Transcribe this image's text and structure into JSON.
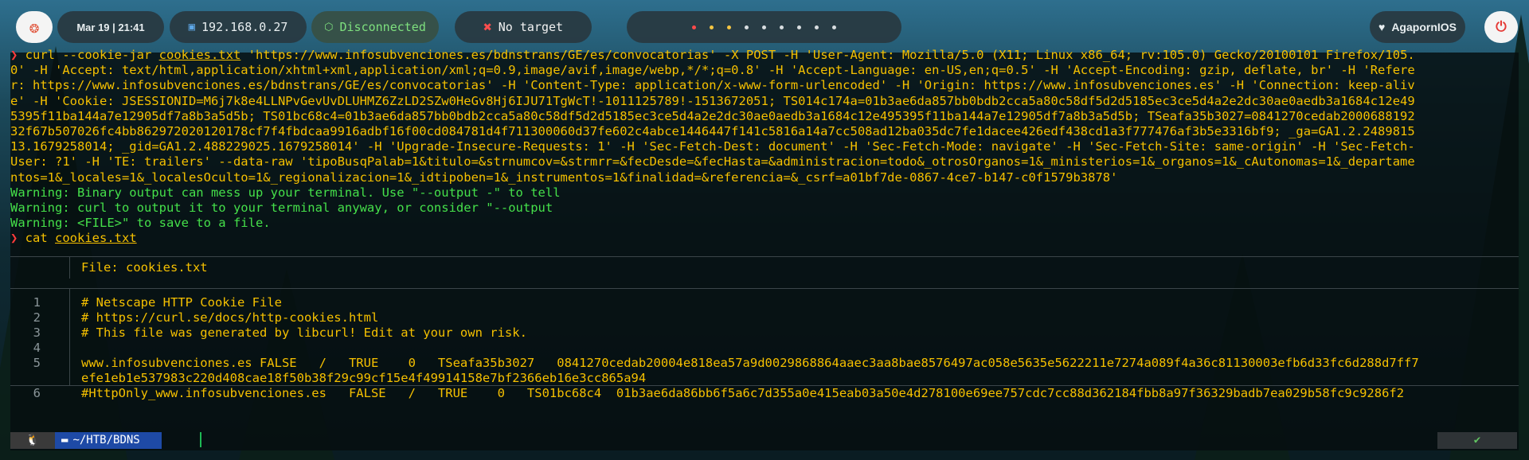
{
  "topbar": {
    "logo_icon": "parrot-logo-icon",
    "date_time": "Mar 19  |  21:41",
    "ip_address": "192.168.0.27",
    "vpn_status": "Disconnected",
    "target": "No target",
    "user": "AgapornIOS",
    "workspaces_count": 9,
    "active_workspace": 1
  },
  "terminal": {
    "lines": [
      {
        "kind": "cmd",
        "prompt": "❯ ",
        "pre": "curl --cookie-jar ",
        "link": "cookies.txt",
        "post": " 'https://www.infosubvenciones.es/bdnstrans/GE/es/convocatorias' -X POST -H 'User-Agent: Mozilla/5.0 (X11; Linux x86_64; rv:105.0) Gecko/20100101 Firefox/105."
      },
      {
        "kind": "cont",
        "text": "0' -H 'Accept: text/html,application/xhtml+xml,application/xml;q=0.9,image/avif,image/webp,*/*;q=0.8' -H 'Accept-Language: en-US,en;q=0.5' -H 'Accept-Encoding: gzip, deflate, br' -H 'Refere"
      },
      {
        "kind": "cont",
        "text": "r: https://www.infosubvenciones.es/bdnstrans/GE/es/convocatorias' -H 'Content-Type: application/x-www-form-urlencoded' -H 'Origin: https://www.infosubvenciones.es' -H 'Connection: keep-aliv"
      },
      {
        "kind": "cont",
        "text": "e' -H 'Cookie: JSESSIONID=M6j7k8e4LLNPvGevUvDLUHMZ6ZzLD2SZw0HeGv8Hj6IJU71TgWcT!-1011125789!-1513672051; TS014c174a=01b3ae6da857bb0bdb2cca5a80c58df5d2d5185ec3ce5d4a2e2dc30ae0aedb3a1684c12e49"
      },
      {
        "kind": "cont",
        "text": "5395f11ba144a7e12905df7a8b3a5d5b; TS01bc68c4=01b3ae6da857bb0bdb2cca5a80c58df5d2d5185ec3ce5d4a2e2dc30ae0aedb3a1684c12e495395f11ba144a7e12905df7a8b3a5d5b; TSeafa35b3027=0841270cedab2000688192"
      },
      {
        "kind": "cont",
        "text": "32f67b507026fc4bb862972020120178cf7f4fbdcaa9916adbf16f00cd084781d4f711300060d37fe602c4abce1446447f141c5816a14a7cc508ad12ba035dc7fe1dacee426edf438cd1a3f777476af3b5e3316bf9; _ga=GA1.2.2489815"
      },
      {
        "kind": "cont",
        "text": "13.1679258014; _gid=GA1.2.488229025.1679258014' -H 'Upgrade-Insecure-Requests: 1' -H 'Sec-Fetch-Dest: document' -H 'Sec-Fetch-Mode: navigate' -H 'Sec-Fetch-Site: same-origin' -H 'Sec-Fetch-"
      },
      {
        "kind": "cont",
        "text": "User: ?1' -H 'TE: trailers' --data-raw 'tipoBusqPalab=1&titulo=&strnumcov=&strmrr=&fecDesde=&fecHasta=&administracion=todo&_otrosOrganos=1&_ministerios=1&_organos=1&_cAutonomas=1&_departame"
      },
      {
        "kind": "cont",
        "text": "ntos=1&_locales=1&_localesOculto=1&_regionalizacion=1&_idtipoben=1&_instrumentos=1&finalidad=&referencia=&_csrf=a01bf7de-0867-4ce7-b147-c0f1579b3878'"
      },
      {
        "kind": "warn",
        "text": "Warning: Binary output can mess up your terminal. Use \"--output -\" to tell"
      },
      {
        "kind": "warn",
        "text": "Warning: curl to output it to your terminal anyway, or consider \"--output"
      },
      {
        "kind": "warn",
        "text": "Warning: <FILE>\" to save to a file."
      },
      {
        "kind": "cat",
        "prompt": "❯ ",
        "pre": "cat ",
        "link": "cookies.txt"
      }
    ],
    "bat": {
      "file_label": "File: cookies.txt",
      "rows": [
        {
          "num": "1",
          "lines": [
            "# Netscape HTTP Cookie File"
          ]
        },
        {
          "num": "2",
          "lines": [
            "# https://curl.se/docs/http-cookies.html"
          ]
        },
        {
          "num": "3",
          "lines": [
            "# This file was generated by libcurl! Edit at your own risk."
          ]
        },
        {
          "num": "4",
          "lines": [
            ""
          ]
        },
        {
          "num": "5",
          "lines": [
            "www.infosubvenciones.es FALSE   /   TRUE    0   TSeafa35b3027   0841270cedab20004e818ea57a9d0029868864aaec3aa8bae8576497ac058e5635e5622211e7274a089f4a36c81130003efb6d33fc6d288d7ff7",
            "efe1eb1e537983c220d408cae18f50b38f29c99cf15e4f49914158e7bf2366eb16e3cc865a94"
          ]
        },
        {
          "num": "6",
          "lines": [
            "#HttpOnly_www.infosubvenciones.es   FALSE   /   TRUE    0   TS01bc68c4  01b3ae6da86bb6f5a6c7d355a0e415eab03a50e4d278100e69ee757cdc7cc88d362184fbb8a97f36329badb7ea029b58fc9c9286f2"
          ]
        }
      ]
    },
    "statusline": {
      "os_icon": "tux-icon",
      "folder_icon": "folder-icon",
      "path": "~/HTB/BDNS",
      "check": "✔"
    }
  }
}
